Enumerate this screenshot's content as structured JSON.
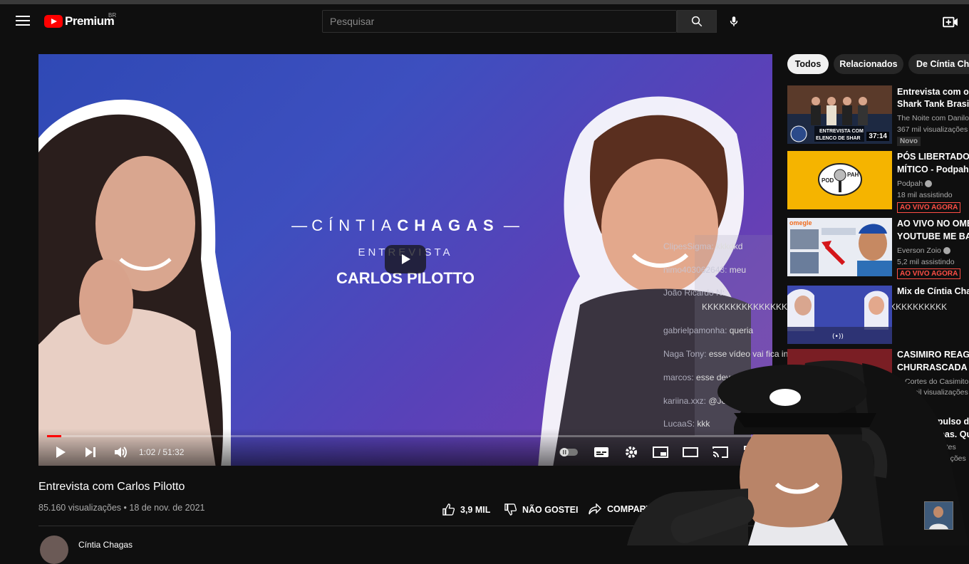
{
  "masthead": {
    "logo_text": "Premium",
    "country_code": "BR",
    "search_placeholder": "Pesquisar"
  },
  "player": {
    "overlay": {
      "name_light": "CÍNTIA",
      "name_bold": "CHAGAS",
      "subtitle": "ENTREVISTA",
      "guest": "CARLOS PILOTTO"
    },
    "time_display": "1:02 / 51:32",
    "progress": 0.02,
    "chat": [
      {
        "user": "ClipesSigma:",
        "text": "kkkdkd"
      },
      {
        "user": "nimo403062643:",
        "text": "meu"
      },
      {
        "user": "João Ricardo N:",
        "text": ""
      },
      {
        "user": "",
        "text": "KKKKKKKKKKKKKKKKKKKKKKKKKKKKKKKKKKKKKKKKKKKKKK"
      },
      {
        "user": "gabrielpamonha:",
        "text": "queria"
      },
      {
        "user": "Naga Tony:",
        "text": "esse vídeo vai fica in sexto lugar"
      },
      {
        "user": "marcos:",
        "text": "esse deve ser"
      },
      {
        "user": "kariina.xxz:",
        "text": "@Jos"
      },
      {
        "user": "LucaaS:",
        "text": "kkk"
      }
    ]
  },
  "video": {
    "title": "Entrevista com Carlos Pilotto",
    "meta": "85.160 visualizações • 18 de nov. de 2021",
    "likes": "3,9 MIL",
    "dislike_label": "NÃO GOSTEI",
    "share_label": "COMPARTILHAR",
    "channel": "Cíntia Chagas"
  },
  "chips": [
    "Todos",
    "Relacionados",
    "De Cíntia Chagas"
  ],
  "recommendations": [
    {
      "title1": "Entrevista com o e",
      "title2": "Shark Tank Brasil |",
      "channel": "The Noite com Danilo",
      "meta": "367 mil visualizações",
      "badge": "Novo",
      "duration": "37:14",
      "thumb_caption": "ENTREVISTA COM ELENCO DE SHAR"
    },
    {
      "title1": "PÓS LIBERTADORE",
      "title2": "MÍTICO - Podpah #",
      "channel": "Podpah",
      "meta": "18 mil assistindo",
      "badge": "AO VIVO AGORA",
      "thumb_caption": "POD PAH"
    },
    {
      "title1": "AO VIVO NO OMEG",
      "title2": "YOUTUBE ME BAN",
      "channel": "Everson Zoio",
      "meta": "5,2 mil assistindo",
      "badge": "AO VIVO AGORA",
      "thumb_caption": "omegle"
    },
    {
      "title1": "Mix de Cíntia Chag",
      "title2": "",
      "channel": "",
      "meta": "",
      "badge": "",
      "thumb_caption": "(•))"
    },
    {
      "title1": "CASIMIRO REAGE:",
      "title2": "CHURRASCADA DA",
      "channel": "Cortes do Casimito [O",
      "meta": "mil visualizações",
      "badge": ""
    },
    {
      "title1": "é Expulso de",
      "title2": "oupas. Qua",
      "channel": "ocantes",
      "meta": "alizações",
      "badge": ""
    }
  ],
  "colors": {
    "background": "#0f0f0f",
    "brand_red": "#ff0000",
    "live_red": "#ff4e45"
  }
}
